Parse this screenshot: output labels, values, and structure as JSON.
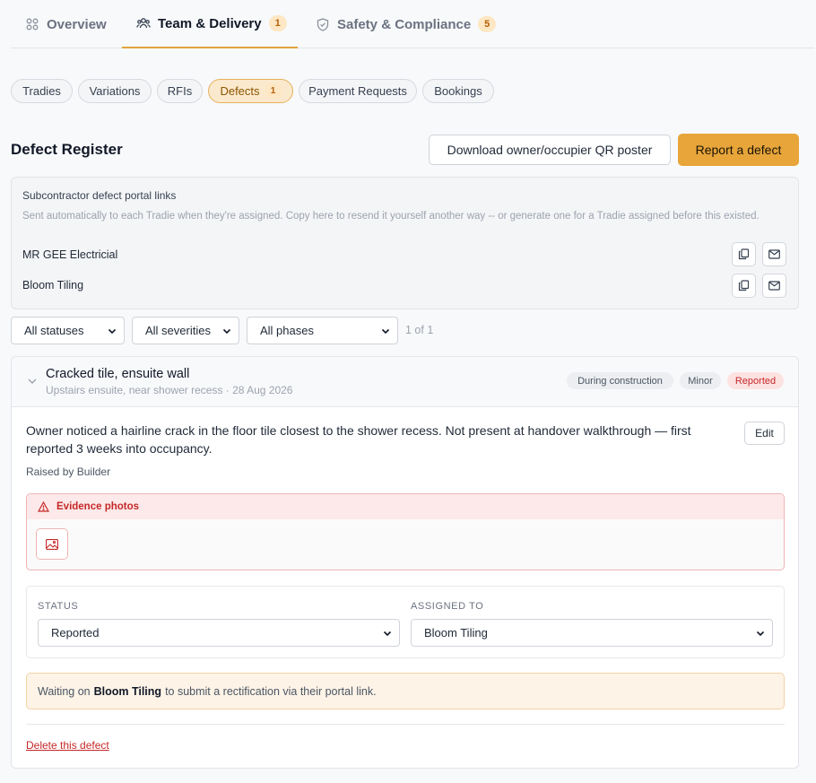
{
  "tabs": [
    {
      "label": "Overview",
      "icon": "grid-icon"
    },
    {
      "label": "Team & Delivery",
      "icon": "team-icon",
      "badge": "1",
      "active": true
    },
    {
      "label": "Safety & Compliance",
      "icon": "shield-icon",
      "badge": "5"
    }
  ],
  "subtabs": [
    {
      "label": "Tradies"
    },
    {
      "label": "Variations"
    },
    {
      "label": "RFIs"
    },
    {
      "label": "Defects",
      "badge": "1",
      "active": true
    },
    {
      "label": "Payment Requests"
    },
    {
      "label": "Bookings"
    }
  ],
  "register": {
    "title": "Defect Register",
    "download_label": "Download owner/occupier QR poster",
    "report_label": "Report a defect"
  },
  "portal": {
    "title": "Subcontractor defect portal links",
    "description": "Sent automatically to each Tradie when they're assigned. Copy here to resend it yourself another way -- or generate one for a Tradie assigned before this existed.",
    "contacts": [
      {
        "name": "MR GEE Electricial"
      },
      {
        "name": "Bloom Tiling"
      }
    ]
  },
  "filters": {
    "status": "All statuses",
    "severity": "All severities",
    "phase": "All phases",
    "count": "1 of 1"
  },
  "defect": {
    "title": "Cracked tile, ensuite wall",
    "subtitle": "Upstairs ensuite, near shower recess · 28 Aug 2026",
    "tags": {
      "phase": "During construction",
      "severity": "Minor",
      "status": "Reported"
    },
    "description": "Owner noticed a hairline crack in the floor tile closest to the shower recess. Not present at handover walkthrough — first reported 3 weeks into occupancy.",
    "raised_prefix": "Raised by",
    "raised_by": "Builder",
    "edit_label": "Edit",
    "evidence_label": "Evidence photos",
    "status_label": "STATUS",
    "status_value": "Reported",
    "assigned_label": "ASSIGNED TO",
    "assigned_value": "Bloom Tiling",
    "waiting_prefix": "Waiting on",
    "waiting_name": "Bloom Tiling",
    "waiting_suffix": "to submit a rectification via their portal link.",
    "delete_label": "Delete this defect"
  },
  "colors": {
    "accent": "#e7a53a",
    "danger": "#c62828",
    "badge_bg": "#fde7c4"
  }
}
